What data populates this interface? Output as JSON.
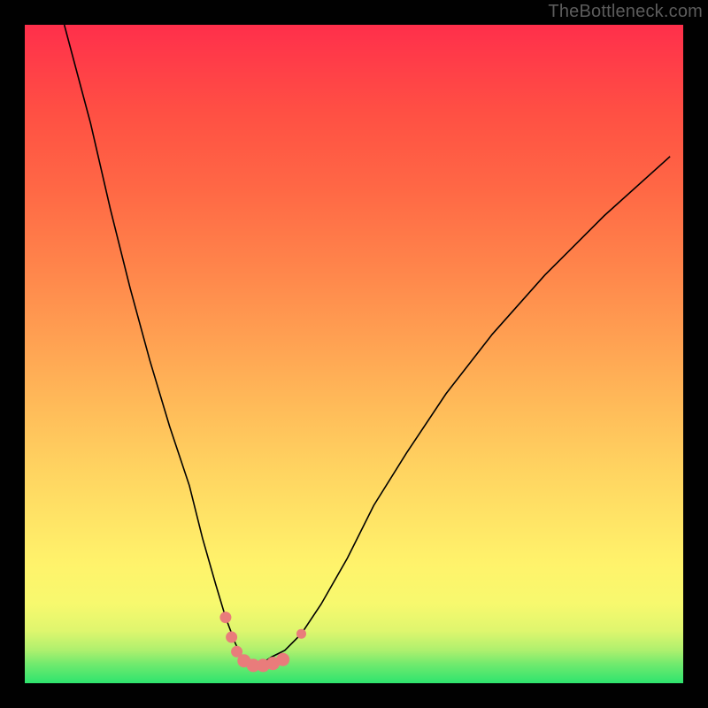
{
  "watermark": "TheBottleneck.com",
  "chart_data": {
    "type": "line",
    "title": "",
    "xlabel": "",
    "ylabel": "",
    "xlim": [
      0,
      100
    ],
    "ylim": [
      0,
      100
    ],
    "grid": false,
    "legend": false,
    "background_gradient": {
      "from": "#2ee46e",
      "to": "#ff2f4b",
      "direction": "bottom-to-top"
    },
    "series": [
      {
        "name": "bottleneck-curve",
        "x": [
          6,
          10,
          13,
          16,
          19,
          22,
          25,
          27,
          29,
          30.5,
          32,
          33,
          34,
          35,
          36,
          37.5,
          39.5,
          42,
          45,
          49,
          53,
          58,
          64,
          71,
          79,
          88,
          98
        ],
        "y": [
          100,
          85,
          72,
          60,
          49,
          39,
          30,
          22,
          15,
          10,
          6,
          4,
          3,
          2.5,
          3,
          4,
          5,
          7.5,
          12,
          19,
          27,
          35,
          44,
          53,
          62,
          71,
          80
        ],
        "color": "#000000",
        "stroke_width": 1.6
      }
    ],
    "markers": {
      "name": "selection-markers",
      "color": "#e97c7b",
      "points": [
        {
          "x": 30.5,
          "y": 10,
          "r": 6.5
        },
        {
          "x": 31.4,
          "y": 7,
          "r": 6.5
        },
        {
          "x": 32.2,
          "y": 4.8,
          "r": 6.5
        },
        {
          "x": 33.3,
          "y": 3.4,
          "r": 7.5
        },
        {
          "x": 34.7,
          "y": 2.7,
          "r": 7.5
        },
        {
          "x": 36.2,
          "y": 2.7,
          "r": 7.5
        },
        {
          "x": 37.7,
          "y": 3.0,
          "r": 7.5
        },
        {
          "x": 39.2,
          "y": 3.6,
          "r": 7.5
        },
        {
          "x": 42.0,
          "y": 7.5,
          "r": 5.5
        }
      ]
    }
  }
}
